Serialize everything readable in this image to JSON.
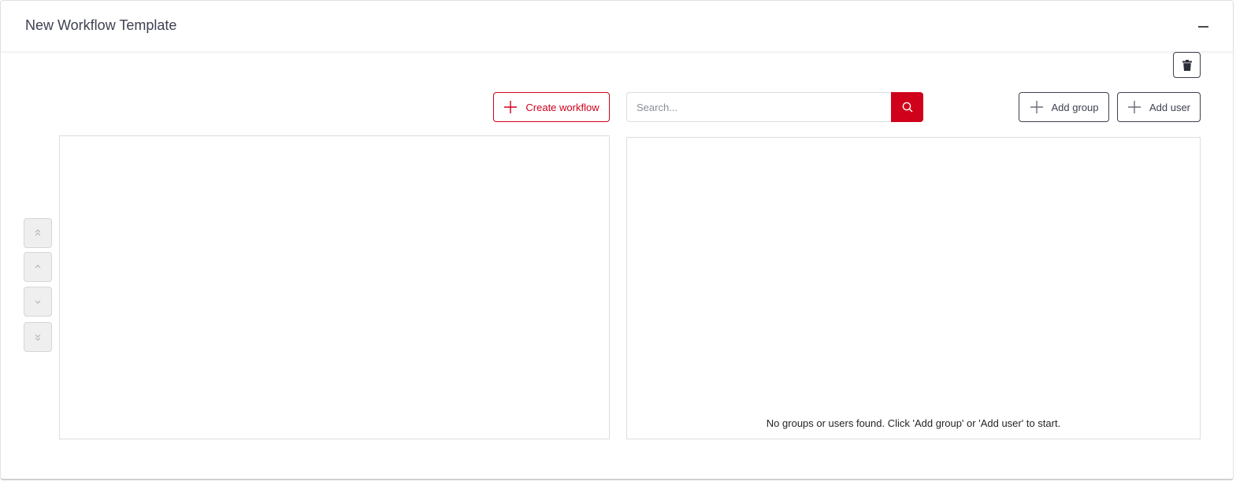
{
  "header": {
    "title": "New Workflow Template"
  },
  "toolbar": {
    "create_workflow_label": "Create workflow",
    "add_group_label": "Add group",
    "add_user_label": "Add user"
  },
  "search": {
    "placeholder": "Search...",
    "value": ""
  },
  "members": {
    "empty_message": "No groups or users found. Click 'Add group' or 'Add user' to start."
  },
  "order_controls": [
    {
      "icon": "double-chevron-up-icon"
    },
    {
      "icon": "chevron-up-icon"
    },
    {
      "icon": "chevron-down-icon"
    },
    {
      "icon": "double-chevron-down-icon"
    }
  ],
  "colors": {
    "accent": "#d0021b",
    "dark": "#3e4150"
  }
}
